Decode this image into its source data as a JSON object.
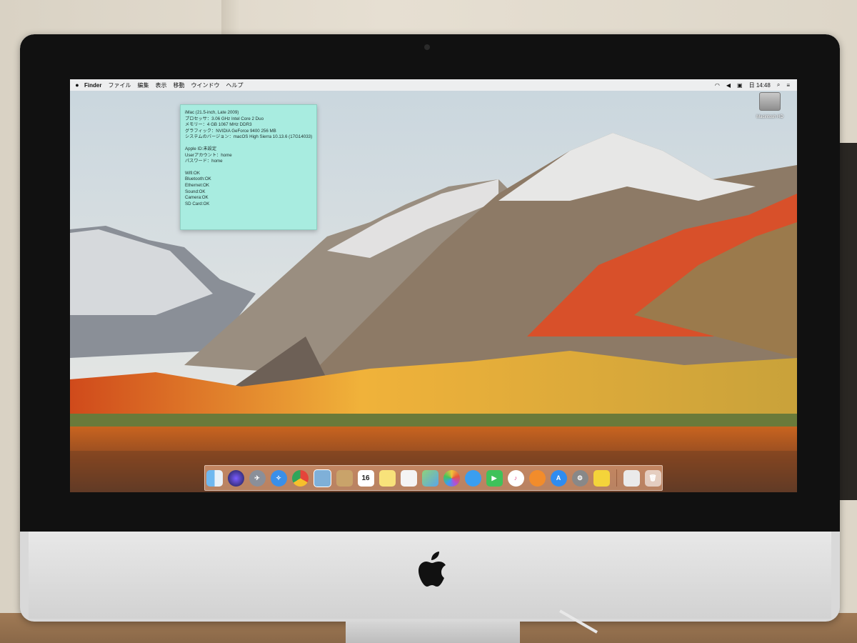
{
  "menubar": {
    "apple": "",
    "app": "Finder",
    "items": [
      "ファイル",
      "編集",
      "表示",
      "移動",
      "ウインドウ",
      "ヘルプ"
    ],
    "time": "日 14:48"
  },
  "note": {
    "lines": [
      "iMac (21.5-inch, Late 2009)",
      "プロセッサ：3.06 GHz Intel Core 2 Duo",
      "メモリー：4 GB 1067 MHz DDR3",
      "グラフィック：NVIDIA GeForce 9400 256 MB",
      "システムのバージョン：macOS High Sierra 10.13.6 (17G14033)",
      "",
      "Apple ID:未設定",
      "Userアカウント：home",
      "パスワード：home",
      "",
      "Wifi:OK",
      "Bluetooth:OK",
      "Ethernet:OK",
      "Sound:OK",
      "Camera:OK",
      "SD Card:OK"
    ]
  },
  "desktop": {
    "hd_label": "Macintosh HD"
  },
  "dock": {
    "calendar_day": "16",
    "icons": [
      "finder-icon",
      "siri-icon",
      "launchpad-icon",
      "safari-icon",
      "chrome-icon",
      "preview-icon",
      "notes-icon",
      "calendar-icon",
      "notes-pad-icon",
      "reminders-icon",
      "maps-icon",
      "photos-icon",
      "messages-icon",
      "facetime-icon",
      "itunes-icon",
      "ibooks-icon",
      "app-store-icon",
      "system-preferences-icon",
      "stickies-icon",
      "documents-icon",
      "trash-icon"
    ]
  },
  "colors": {
    "note_bg": "#a8ece0",
    "dock_tint": "#ffbe96"
  }
}
